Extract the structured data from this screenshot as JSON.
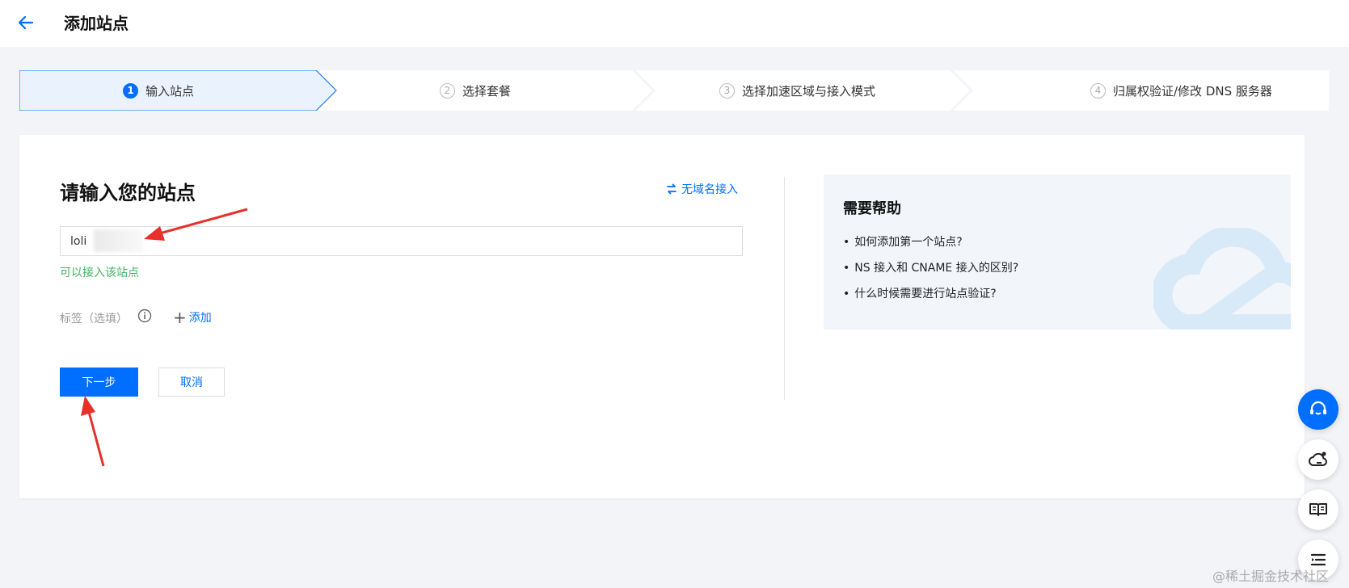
{
  "header": {
    "title": "添加站点"
  },
  "steps": [
    {
      "num": "1",
      "label": "输入站点",
      "active": true
    },
    {
      "num": "2",
      "label": "选择套餐",
      "active": false
    },
    {
      "num": "3",
      "label": "选择加速区域与接入模式",
      "active": false
    },
    {
      "num": "4",
      "label": "归属权验证/修改 DNS 服务器",
      "active": false
    }
  ],
  "form": {
    "title": "请输入您的站点",
    "no_domain_link": "无域名接入",
    "site_value": "loli",
    "valid_message": "可以接入该站点",
    "tag_label": "标签（选填）",
    "tag_add": "添加",
    "next_button": "下一步",
    "cancel_button": "取消"
  },
  "help": {
    "title": "需要帮助",
    "items": [
      "如何添加第一个站点?",
      "NS 接入和 CNAME 接入的区别?",
      "什么时候需要进行站点验证?"
    ]
  },
  "floating": [
    "headset-icon",
    "cloud-icon",
    "book-icon",
    "list-icon"
  ],
  "watermark": "@稀土掘金技术社区",
  "colors": {
    "accent": "#006eff",
    "success": "#3db360",
    "annotation": "#e8302a"
  }
}
